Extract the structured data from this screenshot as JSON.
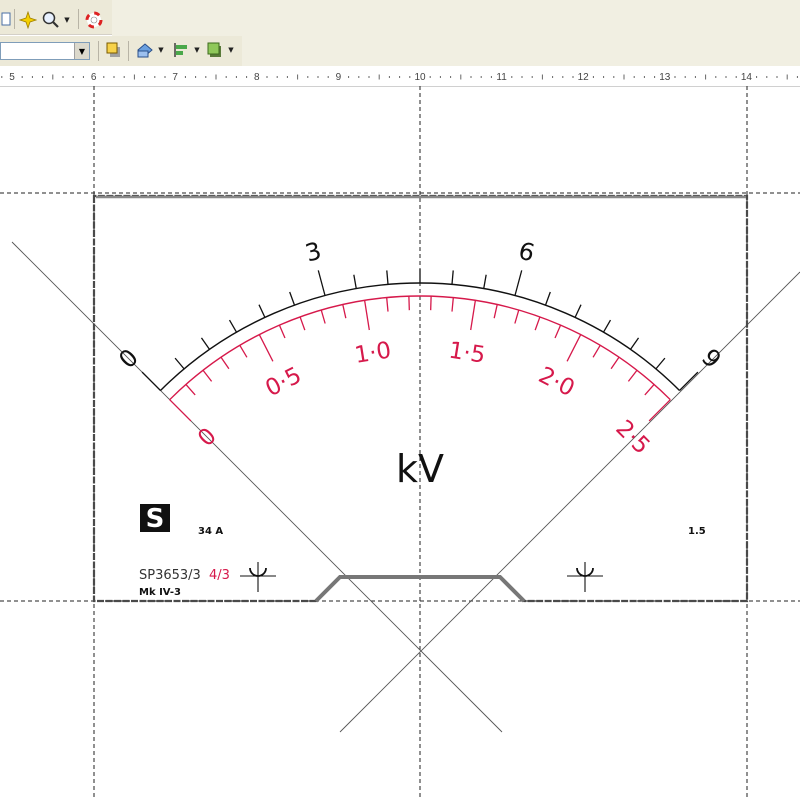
{
  "toolbar": {
    "icons": [
      "document-icon",
      "star-icon",
      "zoom-icon",
      "help-lifebuoy-icon",
      "bring-to-front-icon",
      "rotate-icon",
      "align-icon",
      "shape-fill-icon"
    ]
  },
  "font_select": {
    "value": ""
  },
  "ruler": {
    "labels": [
      "5",
      "6",
      "7",
      "8",
      "9",
      "10",
      "11",
      "12",
      "13",
      "14"
    ]
  },
  "meter": {
    "outer_scale": {
      "labels": [
        "0",
        "3",
        "6",
        "9"
      ],
      "values": [
        0,
        3,
        6,
        9
      ],
      "max": 9,
      "color": "#111111"
    },
    "inner_scale": {
      "labels": [
        "0",
        "0·5",
        "1·0",
        "1·5",
        "2·0",
        "2·5"
      ],
      "values": [
        0,
        0.5,
        1.0,
        1.5,
        2.0,
        2.5
      ],
      "max": 2.5,
      "color": "#d6194b"
    },
    "unit": "kV",
    "model_number": "34 A",
    "accuracy_class": "1.5",
    "part_code": "SP3653/3",
    "part_code_suffix": "4/3",
    "mark": "Mk IV-3",
    "logo": "S"
  }
}
